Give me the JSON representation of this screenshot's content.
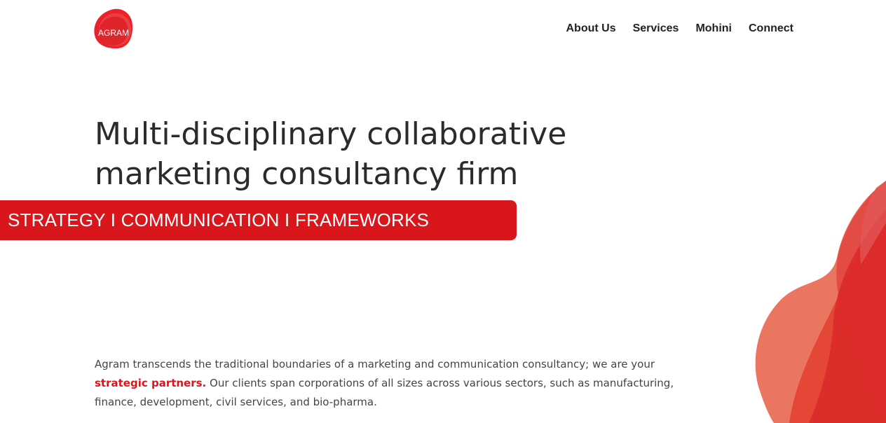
{
  "brand": {
    "logo_text": "AGRAM",
    "accent_color": "#d9161c"
  },
  "nav": {
    "items": [
      {
        "label": "About Us"
      },
      {
        "label": "Services"
      },
      {
        "label": "Mohini"
      },
      {
        "label": "Connect"
      }
    ]
  },
  "hero": {
    "title_line1": "Multi-disciplinary collaborative",
    "title_line2": "marketing consultancy firm",
    "tagline": "STRATEGY I COMMUNICATION I FRAMEWORKS"
  },
  "intro": {
    "text_before": "Agram transcends the traditional boundaries of a marketing and communication consultancy; we are your",
    "highlight": "strategic partners.",
    "text_after": "Our clients span corporations of all sizes across various sectors, such as manufacturing, finance, development, civil services, and bio-pharma."
  },
  "decor": {
    "blob_icon": "abstract-red-blob-shape"
  }
}
